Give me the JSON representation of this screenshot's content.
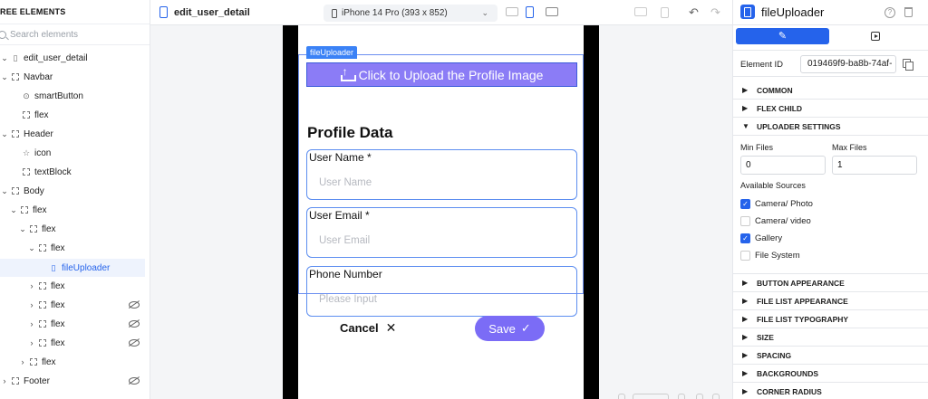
{
  "tree": {
    "title": "REE ELEMENTS",
    "search_placeholder": "Search elements",
    "nodes": [
      {
        "label": "edit_user_detail"
      },
      {
        "label": "Navbar"
      },
      {
        "label": "smartButton"
      },
      {
        "label": "flex"
      },
      {
        "label": "Header"
      },
      {
        "label": "icon"
      },
      {
        "label": "textBlock"
      },
      {
        "label": "Body"
      },
      {
        "label": "flex"
      },
      {
        "label": "flex"
      },
      {
        "label": "flex"
      },
      {
        "label": "fileUploader"
      },
      {
        "label": "flex"
      },
      {
        "label": "flex"
      },
      {
        "label": "flex"
      },
      {
        "label": "flex"
      },
      {
        "label": "flex"
      },
      {
        "label": "Footer"
      }
    ]
  },
  "topbar": {
    "doc_title": "edit_user_detail",
    "device": "iPhone 14 Pro (393 x 852)"
  },
  "canvas": {
    "uploader_tag": "fileUploader",
    "upload_button": "Click to Upload the Profile Image",
    "section_title": "Profile Data",
    "fields": [
      {
        "label": "User Name *",
        "placeholder": "User Name"
      },
      {
        "label": "User Email *",
        "placeholder": "User Email"
      },
      {
        "label": "Phone Number",
        "placeholder": "Please Input"
      }
    ],
    "cancel_label": "Cancel",
    "save_label": "Save"
  },
  "panel": {
    "title": "fileUploader",
    "element_id_label": "Element ID",
    "element_id": "019469f9-ba8b-74af-",
    "sections_top": [
      "COMMON",
      "FLEX CHILD",
      "UPLOADER SETTINGS"
    ],
    "min_files_label": "Min Files",
    "max_files_label": "Max Files",
    "min_files": "0",
    "max_files": "1",
    "sources_label": "Available Sources",
    "sources": [
      {
        "label": "Camera/ Photo",
        "checked": true
      },
      {
        "label": "Camera/ video",
        "checked": false
      },
      {
        "label": "Gallery",
        "checked": true
      },
      {
        "label": "File System",
        "checked": false
      }
    ],
    "sections_bottom": [
      "BUTTON APPEARANCE",
      "FILE LIST APPEARANCE",
      "FILE LIST TYPOGRAPHY",
      "SIZE",
      "SPACING",
      "BACKGROUNDS",
      "CORNER RADIUS"
    ]
  },
  "colors": {
    "accent": "#2563eb",
    "upload_button": "#8b7cf6",
    "save_button": "#7b6cf6",
    "field_border": "#5d8ef0"
  }
}
